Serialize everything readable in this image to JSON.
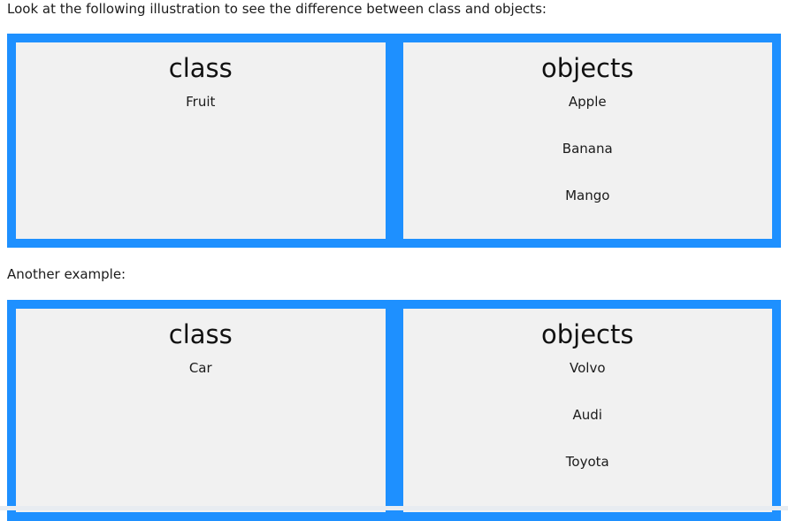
{
  "intro_text": "Look at the following illustration to see the difference between class and objects:",
  "examples": [
    {
      "class_panel": {
        "title": "class",
        "items": [
          "Fruit"
        ]
      },
      "objects_panel": {
        "title": "objects",
        "items": [
          "Apple",
          "Banana",
          "Mango"
        ]
      }
    },
    {
      "class_panel": {
        "title": "class",
        "items": [
          "Car"
        ]
      },
      "objects_panel": {
        "title": "objects",
        "items": [
          "Volvo",
          "Audi",
          "Toyota"
        ]
      }
    }
  ],
  "between_text": "Another example:",
  "colors": {
    "frame": "#1e90ff",
    "panel_background": "#f1f1f1"
  }
}
